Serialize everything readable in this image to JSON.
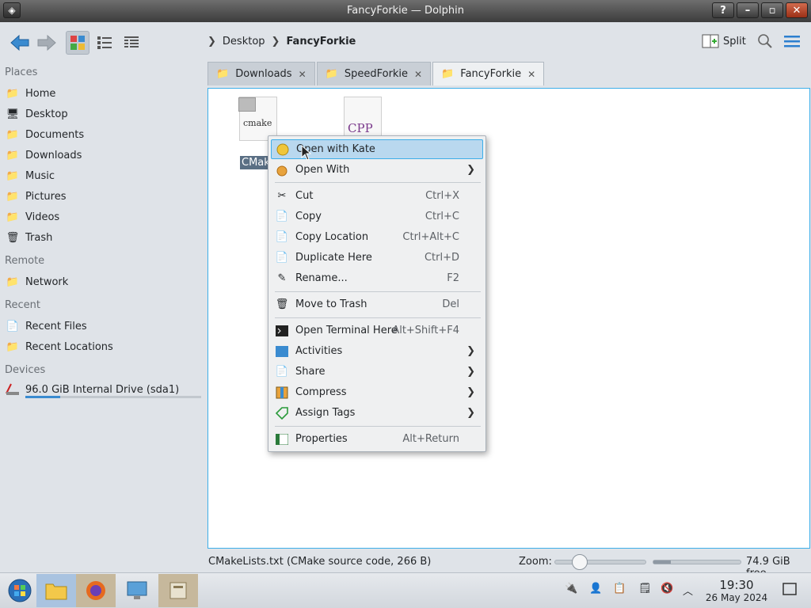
{
  "window": {
    "title": "FancyForkie — Dolphin",
    "help": "?",
    "minimize": "–",
    "maximize": "▫",
    "close": "✕"
  },
  "breadcrumb": [
    "Desktop",
    "FancyForkie"
  ],
  "toolbar": {
    "split_label": "Split"
  },
  "sidebar": {
    "sections": {
      "places": "Places",
      "remote": "Remote",
      "recent": "Recent",
      "devices": "Devices"
    },
    "places": [
      "Home",
      "Desktop",
      "Documents",
      "Downloads",
      "Music",
      "Pictures",
      "Videos",
      "Trash"
    ],
    "remote": [
      "Network"
    ],
    "recent": [
      "Recent Files",
      "Recent Locations"
    ],
    "devices": [
      {
        "label": "96.0 GiB Internal Drive (sda1)",
        "usage": 0.2
      }
    ]
  },
  "tabs": [
    {
      "label": "Downloads",
      "active": false
    },
    {
      "label": "SpeedForkie",
      "active": false
    },
    {
      "label": "FancyForkie",
      "active": true
    }
  ],
  "files": [
    {
      "name": "CMakeLi",
      "icon_text": "cmake",
      "selected": true
    },
    {
      "name": "",
      "icon_text": "CPP",
      "selected": false
    }
  ],
  "context_menu": [
    {
      "label": "Open with Kate",
      "shortcut": "",
      "submenu": false,
      "icon": "kate-icon"
    },
    {
      "label": "Open With",
      "shortcut": "",
      "submenu": true,
      "icon": "open-with-icon"
    },
    {
      "label": "Cut",
      "shortcut": "Ctrl+X",
      "submenu": false,
      "icon": "cut-icon"
    },
    {
      "label": "Copy",
      "shortcut": "Ctrl+C",
      "submenu": false,
      "icon": "copy-icon"
    },
    {
      "label": "Copy Location",
      "shortcut": "Ctrl+Alt+C",
      "submenu": false,
      "icon": "copy-location-icon"
    },
    {
      "label": "Duplicate Here",
      "shortcut": "Ctrl+D",
      "submenu": false,
      "icon": "duplicate-icon"
    },
    {
      "label": "Rename...",
      "shortcut": "F2",
      "submenu": false,
      "icon": "rename-icon"
    },
    {
      "label": "Move to Trash",
      "shortcut": "Del",
      "submenu": false,
      "icon": "trash-icon"
    },
    {
      "label": "Open Terminal Here",
      "shortcut": "Alt+Shift+F4",
      "submenu": false,
      "icon": "terminal-icon"
    },
    {
      "label": "Activities",
      "shortcut": "",
      "submenu": true,
      "icon": "activities-icon"
    },
    {
      "label": "Share",
      "shortcut": "",
      "submenu": true,
      "icon": "share-icon"
    },
    {
      "label": "Compress",
      "shortcut": "",
      "submenu": true,
      "icon": "compress-icon"
    },
    {
      "label": "Assign Tags",
      "shortcut": "",
      "submenu": true,
      "icon": "tag-icon"
    },
    {
      "label": "Properties",
      "shortcut": "Alt+Return",
      "submenu": false,
      "icon": "properties-icon"
    }
  ],
  "status": {
    "file_info": "CMakeLists.txt (CMake source code, 266 B)",
    "zoom_label": "Zoom:",
    "free_space": "74.9 GiB free"
  },
  "taskbar": {
    "time": "19:30",
    "date": "26 May 2024"
  },
  "colors": {
    "accent": "#3daee9",
    "highlight": "#b9d8ef",
    "titlebar": "#4a4a4a"
  }
}
